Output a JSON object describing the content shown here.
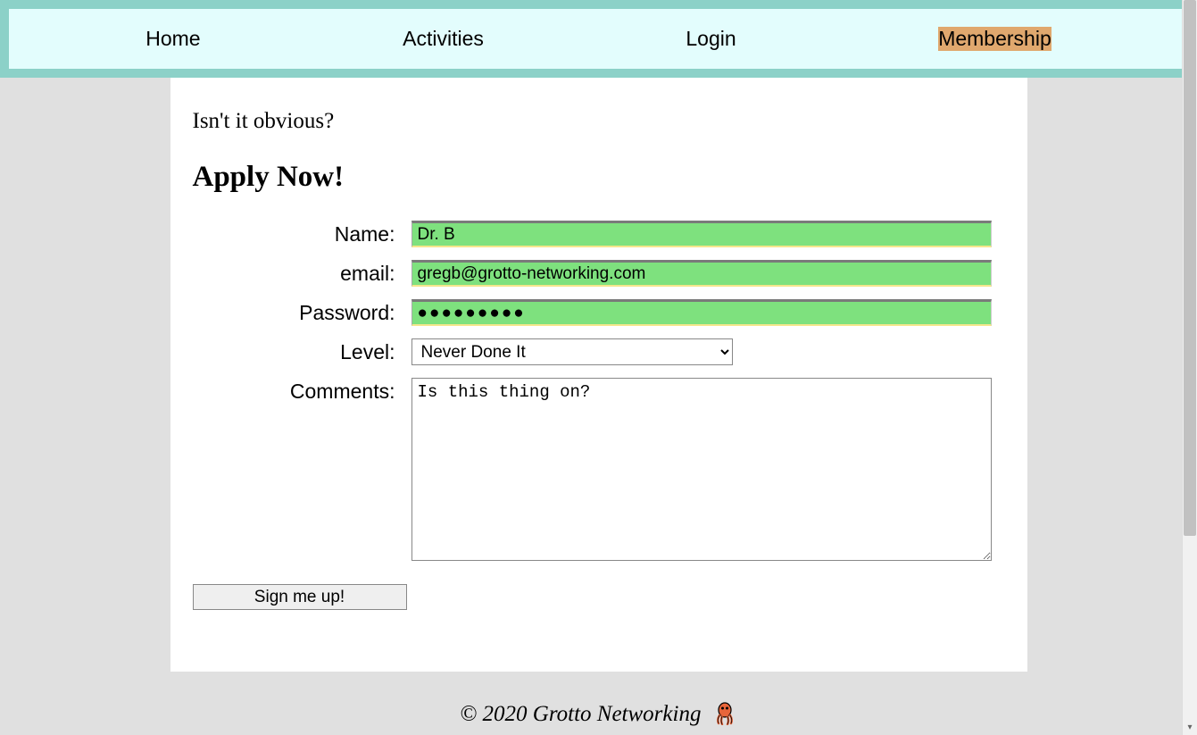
{
  "nav": {
    "items": [
      {
        "label": "Home",
        "active": false
      },
      {
        "label": "Activities",
        "active": false
      },
      {
        "label": "Login",
        "active": false
      },
      {
        "label": "Membership",
        "active": true
      }
    ]
  },
  "page": {
    "subtitle": "Isn't it obvious?",
    "title": "Apply Now!"
  },
  "form": {
    "name_label": "Name:",
    "name_value": "Dr. B",
    "email_label": "email:",
    "email_value": "gregb@grotto-networking.com",
    "password_label": "Password:",
    "password_value": "●●●●●●●●●",
    "level_label": "Level:",
    "level_value": "Never Done It",
    "comments_label": "Comments:",
    "comments_value": "Is this thing on?",
    "submit_label": "Sign me up!"
  },
  "footer": {
    "text": "© 2020 Grotto Networking",
    "icon_name": "octopus-icon"
  }
}
